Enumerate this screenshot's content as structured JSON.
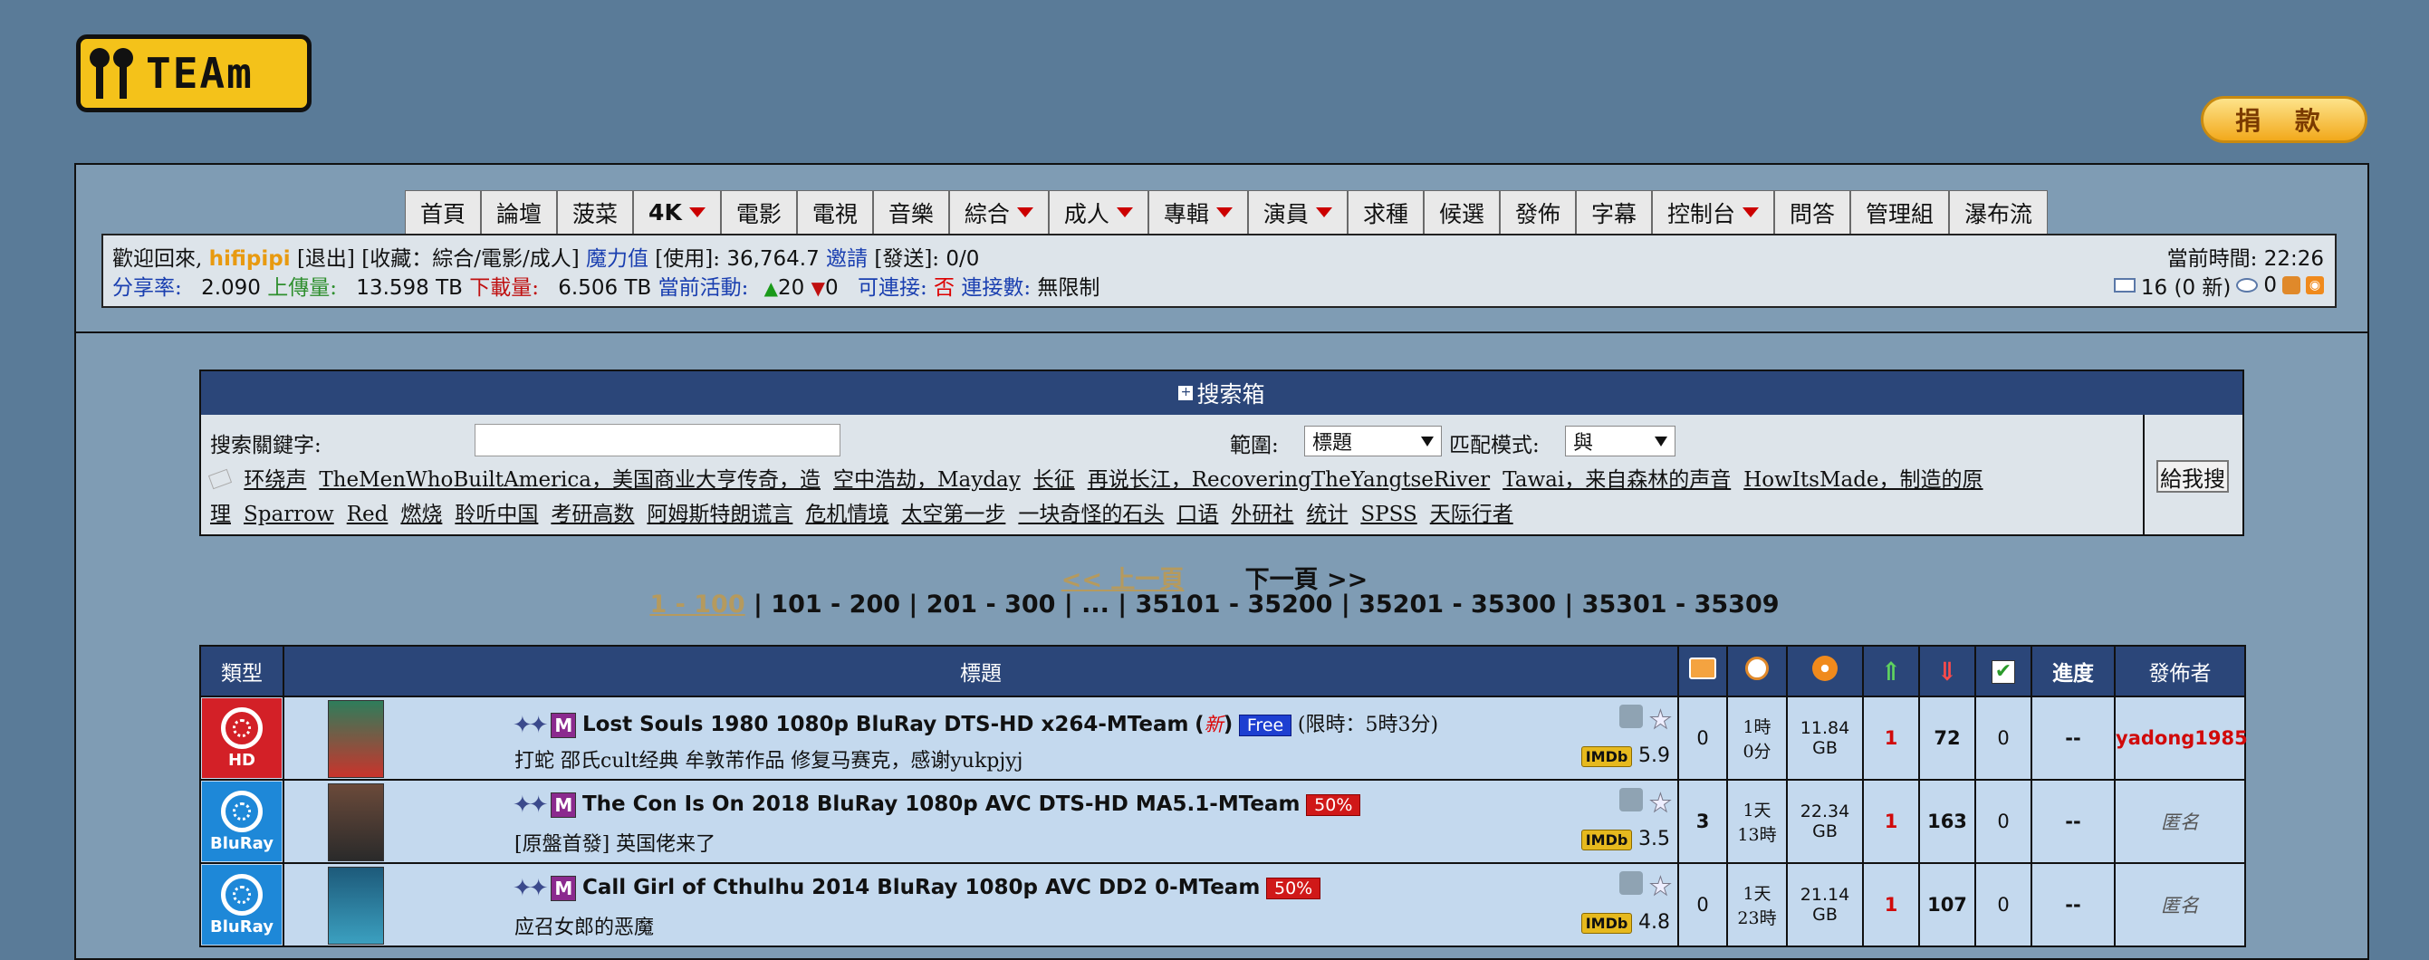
{
  "logo": {
    "text": "TEAm"
  },
  "donate_label": "捐 款",
  "nav": [
    {
      "label": "首頁",
      "dd": false,
      "bold": false
    },
    {
      "label": "論壇",
      "dd": false,
      "bold": false
    },
    {
      "label": "菠菜",
      "dd": false,
      "bold": false
    },
    {
      "label": "4K",
      "dd": true,
      "bold": true
    },
    {
      "label": "電影",
      "dd": false,
      "bold": false
    },
    {
      "label": "電視",
      "dd": false,
      "bold": false
    },
    {
      "label": "音樂",
      "dd": false,
      "bold": false
    },
    {
      "label": "綜合",
      "dd": true,
      "bold": false
    },
    {
      "label": "成人",
      "dd": true,
      "bold": false
    },
    {
      "label": "專輯",
      "dd": true,
      "bold": false
    },
    {
      "label": "演員",
      "dd": true,
      "bold": false
    },
    {
      "label": "求種",
      "dd": false,
      "bold": false
    },
    {
      "label": "候選",
      "dd": false,
      "bold": false
    },
    {
      "label": "發佈",
      "dd": false,
      "bold": false
    },
    {
      "label": "字幕",
      "dd": false,
      "bold": false
    },
    {
      "label": "控制台",
      "dd": true,
      "bold": false
    },
    {
      "label": "問答",
      "dd": false,
      "bold": false
    },
    {
      "label": "管理組",
      "dd": false,
      "bold": false
    },
    {
      "label": "瀑布流",
      "dd": false,
      "bold": false
    }
  ],
  "info": {
    "welcome": "歡迎回來,",
    "username": "hifipipi",
    "logout": "[退出]",
    "collect": "[收藏：綜合/電影/成人]",
    "magic_label": "魔力值",
    "magic_use": "[使用]:",
    "magic_value": "36,764.7",
    "invite_label": "邀請",
    "invite_send": "[發送]:",
    "invite_value": "0/0",
    "ratio_label": "分享率:",
    "ratio_value": "2.090",
    "upload_label": "上傳量:",
    "upload_value": "13.598 TB",
    "download_label": "下載量:",
    "download_value": "6.506 TB",
    "active_label": "當前活動:",
    "active_up": "20",
    "active_down": "0",
    "connectable_label": "可連接:",
    "connectable_value": "否",
    "connections_label": "連接數:",
    "connections_value": "無限制",
    "time_label": "當前時間:",
    "time_value": "22:26",
    "messages": "16 (0 新)",
    "watch_count": "0"
  },
  "search": {
    "title": "搜索箱",
    "keyword_label": "搜索關鍵字:",
    "keyword_value": "",
    "scope_label": "範圍:",
    "scope_value": "標題",
    "match_label": "匹配模式:",
    "match_value": "與",
    "submit": "給我搜",
    "hot_line1": [
      "环绕声",
      "TheMenWhoBuiltAmerica，美国商业大亨传奇，造",
      "空中浩劫，Mayday",
      "长征",
      "再说长江，RecoveringTheYangtseRiver",
      "Tawai，来自森林的声音",
      "HowItsMade，制造的原"
    ],
    "hot_line2": [
      "理",
      "Sparrow",
      "Red",
      "燃烧",
      "聆听中国",
      "考研高数",
      "阿姆斯特朗谎言",
      "危机情境",
      "太空第一步",
      "一块奇怪的石头",
      "口语",
      "外研社",
      "统计",
      "SPSS",
      "天际行者"
    ]
  },
  "pagination": {
    "prev": "<< 上一頁",
    "next": "下一頁 >>",
    "pages": [
      "1 - 100",
      "101 - 200",
      "201 - 300",
      "...",
      "35101 - 35200",
      "35201 - 35300",
      "35301 - 35309"
    ]
  },
  "table": {
    "headers": {
      "type": "類型",
      "title": "標題",
      "progress": "進度",
      "uploader": "發佈者"
    },
    "rows": [
      {
        "category": "HD",
        "cat_color": "#d32027",
        "title": "Lost Souls 1980 1080p BluRay DTS-HD x264-MTeam",
        "new_mark": "新",
        "badge": "Free",
        "badge_type": "free",
        "limit": "(限時：5時3分)",
        "subtitle": "打蛇 邵氏cult经典 牟敦芾作品 修复马赛克，感谢yukpjyj",
        "imdb": "5.9",
        "comments": "0",
        "time": [
          "1時",
          "0分"
        ],
        "size": [
          "11.84",
          "GB"
        ],
        "seeders": "1",
        "leechers": "72",
        "completed": "0",
        "progress": "--",
        "uploader": "yadong1985",
        "anon": false,
        "poster_colors": [
          "#2e7d5b",
          "#c9342c"
        ]
      },
      {
        "category": "BluRay",
        "cat_color": "#1e88d8",
        "title": "The Con Is On 2018 BluRay 1080p AVC DTS-HD MA5.1-MTeam",
        "new_mark": "",
        "badge": "50%",
        "badge_type": "half",
        "limit": "",
        "subtitle": "[原盤首發] 英国佬来了",
        "imdb": "3.5",
        "comments": "3",
        "time": [
          "1天",
          "13時"
        ],
        "size": [
          "22.34",
          "GB"
        ],
        "seeders": "1",
        "leechers": "163",
        "completed": "0",
        "progress": "--",
        "uploader": "匿名",
        "anon": true,
        "poster_colors": [
          "#6b4a3a",
          "#2a2a2a"
        ]
      },
      {
        "category": "BluRay",
        "cat_color": "#1e88d8",
        "title": "Call Girl of Cthulhu 2014 BluRay 1080p AVC DD2 0-MTeam",
        "new_mark": "",
        "badge": "50%",
        "badge_type": "half",
        "limit": "",
        "subtitle": "应召女郎的恶魔",
        "imdb": "4.8",
        "comments": "0",
        "time": [
          "1天",
          "23時"
        ],
        "size": [
          "21.14",
          "GB"
        ],
        "seeders": "1",
        "leechers": "107",
        "completed": "0",
        "progress": "--",
        "uploader": "匿名",
        "anon": true,
        "poster_colors": [
          "#1d5a7a",
          "#3ba0c0"
        ]
      }
    ]
  }
}
